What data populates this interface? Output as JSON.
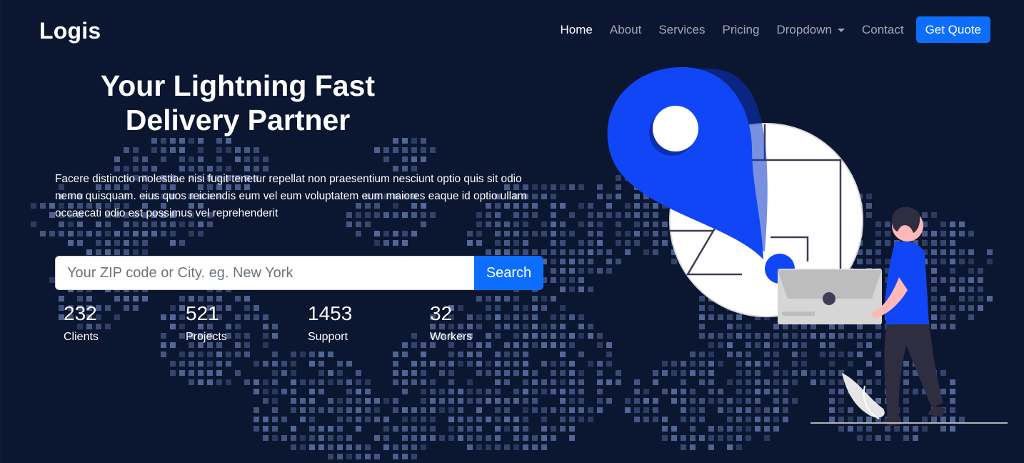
{
  "header": {
    "logo": "Logis",
    "nav": [
      {
        "label": "Home",
        "active": true
      },
      {
        "label": "About",
        "active": false
      },
      {
        "label": "Services",
        "active": false
      },
      {
        "label": "Pricing",
        "active": false
      },
      {
        "label": "Dropdown",
        "active": false,
        "has_caret": true
      },
      {
        "label": "Contact",
        "active": false
      }
    ],
    "cta_label": "Get Quote"
  },
  "hero": {
    "title_line1": "Your Lightning Fast",
    "title_line2": "Delivery Partner",
    "description": "Facere distinctio molestiae nisi fugit tenetur repellat non praesentium nesciunt optio quis sit odio nemo quisquam. eius quos reiciendis eum vel eum voluptatem eum maiores eaque id optio ullam occaecati odio est possimus vel reprehenderit",
    "search": {
      "placeholder": "Your ZIP code or City. eg. New York",
      "value": "",
      "button_label": "Search"
    },
    "stats": [
      {
        "value": "232",
        "label": "Clients"
      },
      {
        "value": "521",
        "label": "Projects"
      },
      {
        "value": "1453",
        "label": "Support"
      },
      {
        "value": "32",
        "label": "Workers"
      }
    ]
  },
  "colors": {
    "background": "#0b1631",
    "accent": "#0d6efd",
    "pin_blue": "#1046f5",
    "dot_color": "#8fa8e8"
  },
  "icons": {
    "dropdown_caret": "chevron-down-icon",
    "illustration": "location-pin-delivery-illustration"
  }
}
